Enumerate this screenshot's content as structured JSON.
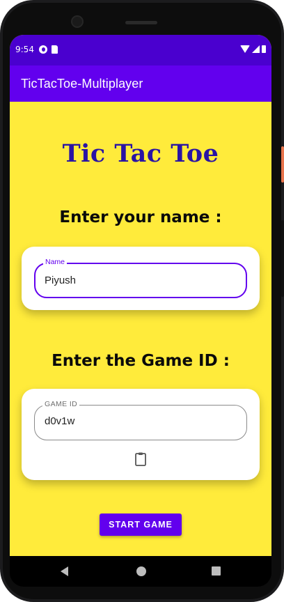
{
  "status_bar": {
    "time": "9:54"
  },
  "app_bar": {
    "title": "TicTacToe-Multiplayer"
  },
  "main": {
    "game_title": "Tic Tac Toe",
    "name_heading": "Enter your name :",
    "name_field": {
      "label": "Name",
      "value": "Piyush"
    },
    "gameid_heading": "Enter the Game ID :",
    "gameid_field": {
      "label": "GAME ID",
      "value": "d0v1w"
    },
    "start_button_label": "START GAME"
  },
  "colors": {
    "background": "#ffeb3b",
    "status_bar": "#4a00cf",
    "app_bar": "#6200ee",
    "title_text": "#2a14a4",
    "accent": "#6200ee"
  },
  "icons": {
    "clipboard": "paste-icon"
  }
}
